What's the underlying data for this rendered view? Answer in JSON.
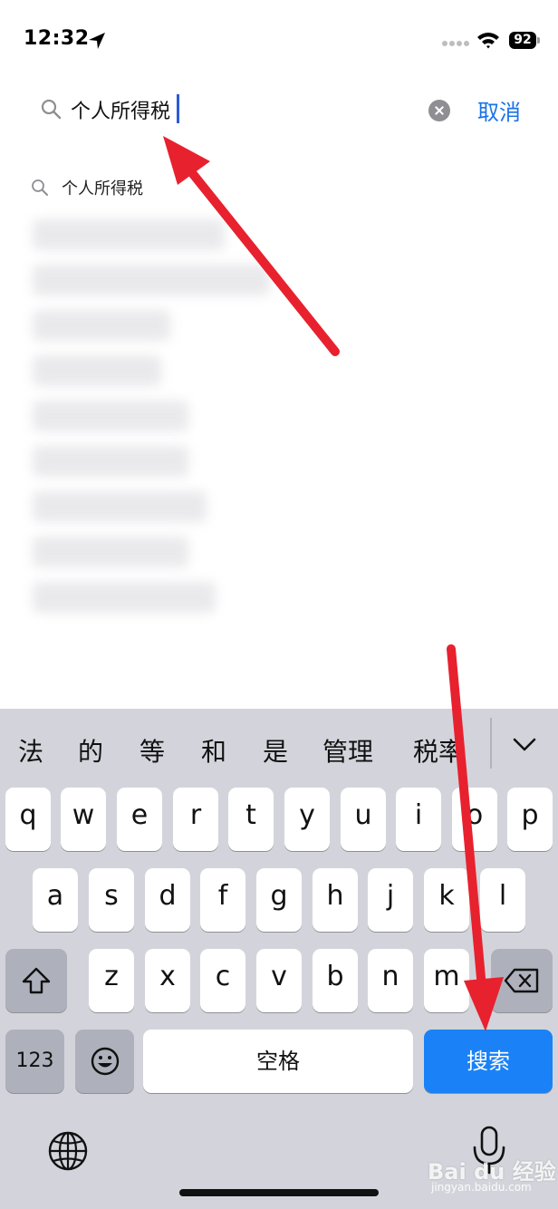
{
  "status_bar": {
    "time": "12:32",
    "battery": "92"
  },
  "search": {
    "query": "个人所得税",
    "cancel_label": "取消"
  },
  "suggestions": [
    {
      "text": "个人所得税"
    }
  ],
  "keyboard": {
    "candidates": [
      "法",
      "的",
      "等",
      "和",
      "是",
      "管理",
      "税率"
    ],
    "row1": [
      "q",
      "w",
      "e",
      "r",
      "t",
      "y",
      "u",
      "i",
      "o",
      "p"
    ],
    "row2": [
      "a",
      "s",
      "d",
      "f",
      "g",
      "h",
      "j",
      "k",
      "l"
    ],
    "row3": [
      "z",
      "x",
      "c",
      "v",
      "b",
      "n",
      "m"
    ],
    "numbers_label": "123",
    "space_label": "空格",
    "search_label": "搜索"
  },
  "watermark": {
    "brand": "Bai du 经验",
    "sub": "jingyan.baidu.com"
  },
  "colors": {
    "accent": "#1a73e8",
    "search_key": "#1a82f6",
    "arrow": "#e8212e",
    "keyboard_bg": "#d3d4db"
  }
}
